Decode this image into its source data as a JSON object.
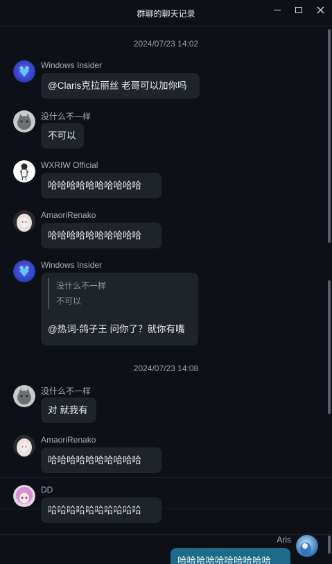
{
  "window": {
    "title": "群聊的聊天记录"
  },
  "timestamps": [
    "2024/07/23 14:02",
    "2024/07/23 14:08"
  ],
  "messages": [
    {
      "sender": "Windows Insider",
      "text": "@Claris克拉丽丝 老哥可以加你吗",
      "avatar_icon": "heart-people-icon"
    },
    {
      "sender": "没什么不一样",
      "text": "不可以",
      "avatar_icon": "grey-cat-avatar"
    },
    {
      "sender": "WXRIW Official",
      "text": "哈哈哈哈哈哈哈哈哈哈",
      "avatar_icon": "cartoon-figure-avatar"
    },
    {
      "sender": "AmaoriRenako",
      "text": "哈哈哈哈哈哈哈哈哈哈",
      "avatar_icon": "anime-girl-avatar"
    },
    {
      "sender": "Windows Insider",
      "quote": [
        "没什么不一样",
        "不可以"
      ],
      "text": "@热词-鸽子王 问你了？就你有嘴",
      "avatar_icon": "heart-people-icon"
    },
    {
      "sender": "没什么不一样",
      "text": "对 就我有",
      "avatar_icon": "grey-cat-avatar"
    },
    {
      "sender": "AmaoriRenako",
      "text": "哈哈哈哈哈哈哈哈哈哈",
      "avatar_icon": "anime-girl-avatar"
    },
    {
      "sender": "DD",
      "text": "哈哈哈哈哈哈哈哈哈哈",
      "avatar_icon": "pink-hair-girl-avatar"
    },
    {
      "sender": "Aris",
      "text": "哈哈哈哈哈哈哈哈哈哈",
      "avatar_icon": "blue-anime-avatar",
      "self": true
    }
  ],
  "colors": {
    "background": "#0d1117",
    "bubble": "#1f242b",
    "self_bubble": "#1d6a8a",
    "sender_text": "#a8adb3"
  }
}
